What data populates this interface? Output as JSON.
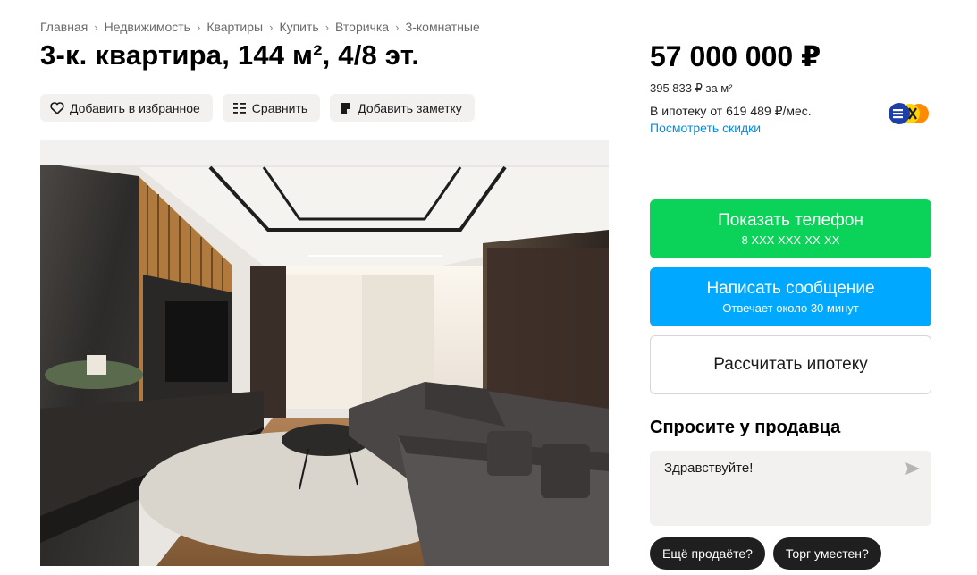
{
  "breadcrumb": {
    "items": [
      "Главная",
      "Недвижимость",
      "Квартиры",
      "Купить",
      "Вторичка",
      "3-комнатные"
    ]
  },
  "listing": {
    "title": "3-к. квартира, 144 м², 4/8 эт."
  },
  "actions": {
    "favorite_label": "Добавить в избранное",
    "compare_label": "Сравнить",
    "note_label": "Добавить заметку"
  },
  "pricing": {
    "price": "57 000 000 ₽",
    "per_meter": "395 833 ₽ за м²",
    "mortgage": "В ипотеку от 619 489 ₽/мес.",
    "discounts_link": "Посмотреть скидки"
  },
  "contact": {
    "phone_label": "Показать телефон",
    "phone_number": "8 XXX XXX-XX-XX",
    "message_label": "Написать сообщение",
    "message_sub": "Отвечает около 30 минут",
    "calc_label": "Рассчитать ипотеку"
  },
  "ask": {
    "title": "Спросите у продавца",
    "input_value": "Здравствуйте!",
    "quick_replies": [
      "Ещё продаёте?",
      "Торг уместен?"
    ]
  },
  "colors": {
    "green": "#0bd35a",
    "blue": "#00a8ff",
    "link": "#0a8bd6",
    "chip": "#1f1f1f"
  },
  "icons": {
    "favorite": "heart-icon",
    "compare": "compare-icon",
    "note": "note-icon",
    "send": "send-icon",
    "bank": "bank-logo-icon"
  }
}
